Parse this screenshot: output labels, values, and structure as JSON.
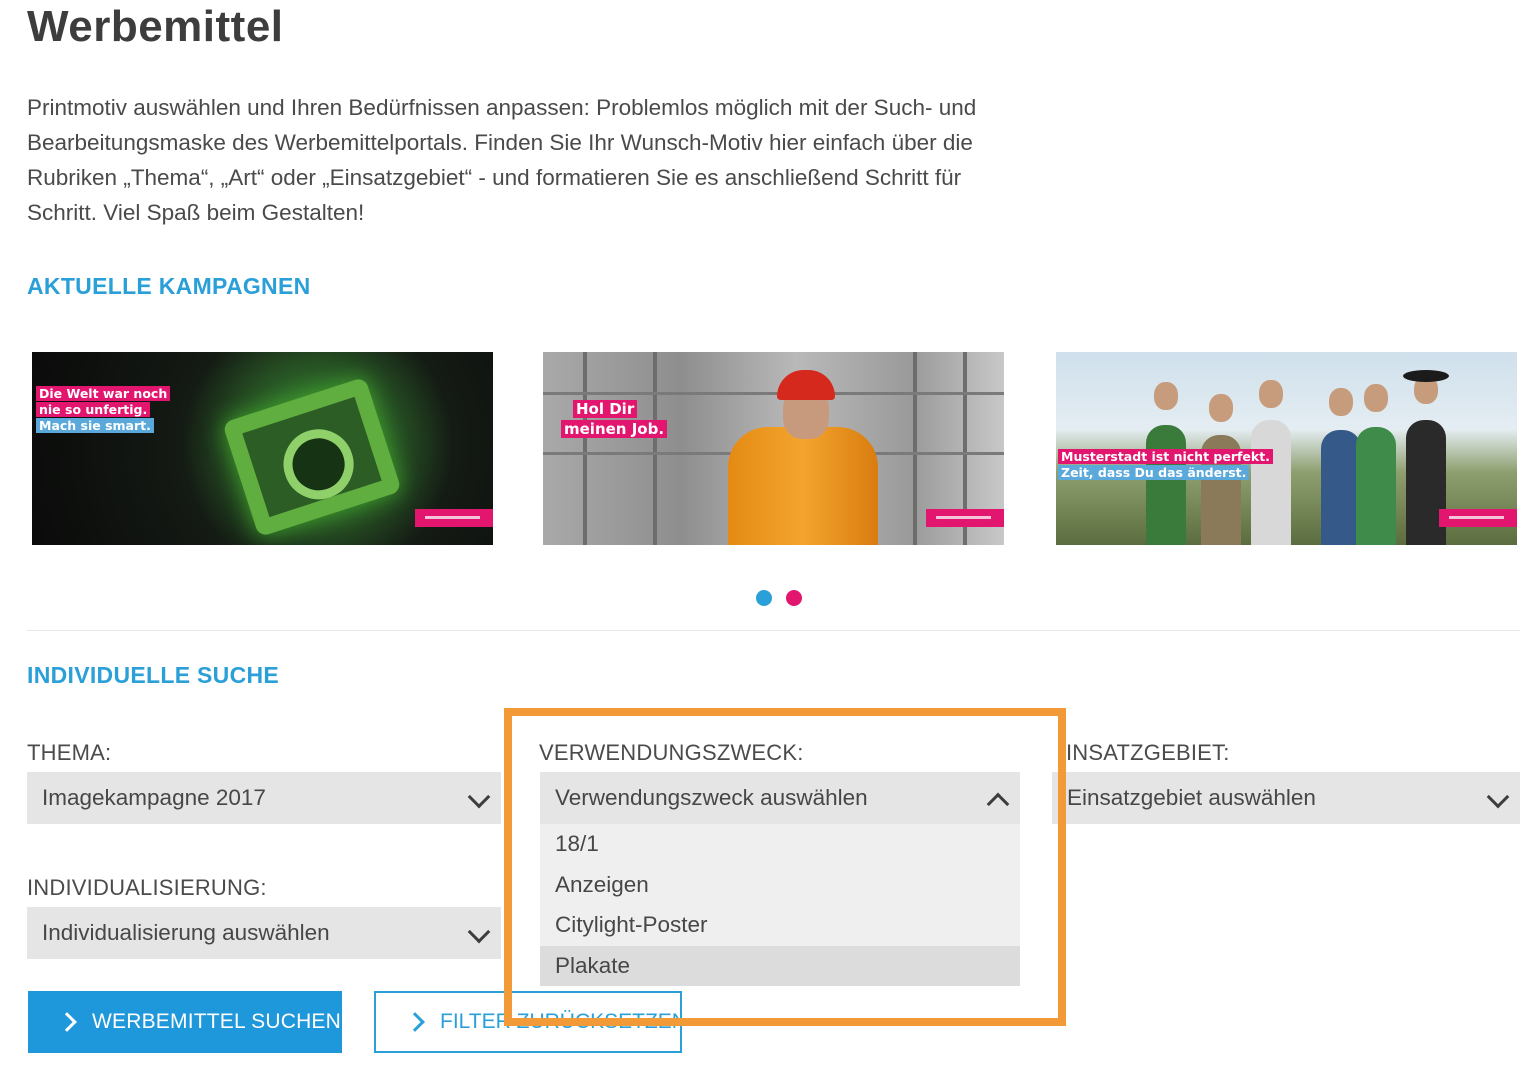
{
  "page": {
    "title": "Werbemittel",
    "intro": "Printmotiv auswählen und Ihren Bedürfnissen anpassen: Problemlos möglich mit der Such- und Bearbeitungsmaske des Werbemittelportals. Finden Sie Ihr Wunsch-Motiv hier einfach über die Rubriken „Thema“, „Art“ oder „Einsatzgebiet“ - und formatieren Sie es anschließend Schritt für Schritt. Viel Spaß beim Gestalten!"
  },
  "campaigns": {
    "heading": "AKTUELLE KAMPAGNEN",
    "slides": [
      {
        "lines": [
          "Die Welt war noch",
          "nie so unfertig.",
          "Mach sie smart."
        ]
      },
      {
        "lines": [
          "Hol Dir",
          "meinen Job."
        ]
      },
      {
        "lines": [
          "Musterstadt ist nicht perfekt.",
          "Zeit, dass Du das änderst."
        ]
      }
    ],
    "pagination_active": 2,
    "colors": {
      "blue": "#2a9fd8",
      "pink": "#e2156f"
    }
  },
  "search": {
    "heading": "INDIVIDUELLE SUCHE",
    "thema": {
      "label": "THEMA:",
      "value": "Imagekampagne 2017"
    },
    "verwendungszweck": {
      "label": "VERWENDUNGSZWECK:",
      "placeholder": "Verwendungszweck auswählen",
      "options": [
        "18/1",
        "Anzeigen",
        "Citylight-Poster",
        "Plakate"
      ],
      "hovered": "Plakate"
    },
    "einsatzgebiet": {
      "label": "INSATZGEBIET:",
      "placeholder": "Einsatzgebiet auswählen"
    },
    "individualisierung": {
      "label": "INDIVIDUALISIERUNG:",
      "placeholder": "Individualisierung auswählen"
    },
    "buttons": {
      "search": "WERBEMITTEL SUCHEN",
      "reset": "FILTER ZURÜCKSETZEN"
    },
    "highlight_color": "#f29a38"
  }
}
